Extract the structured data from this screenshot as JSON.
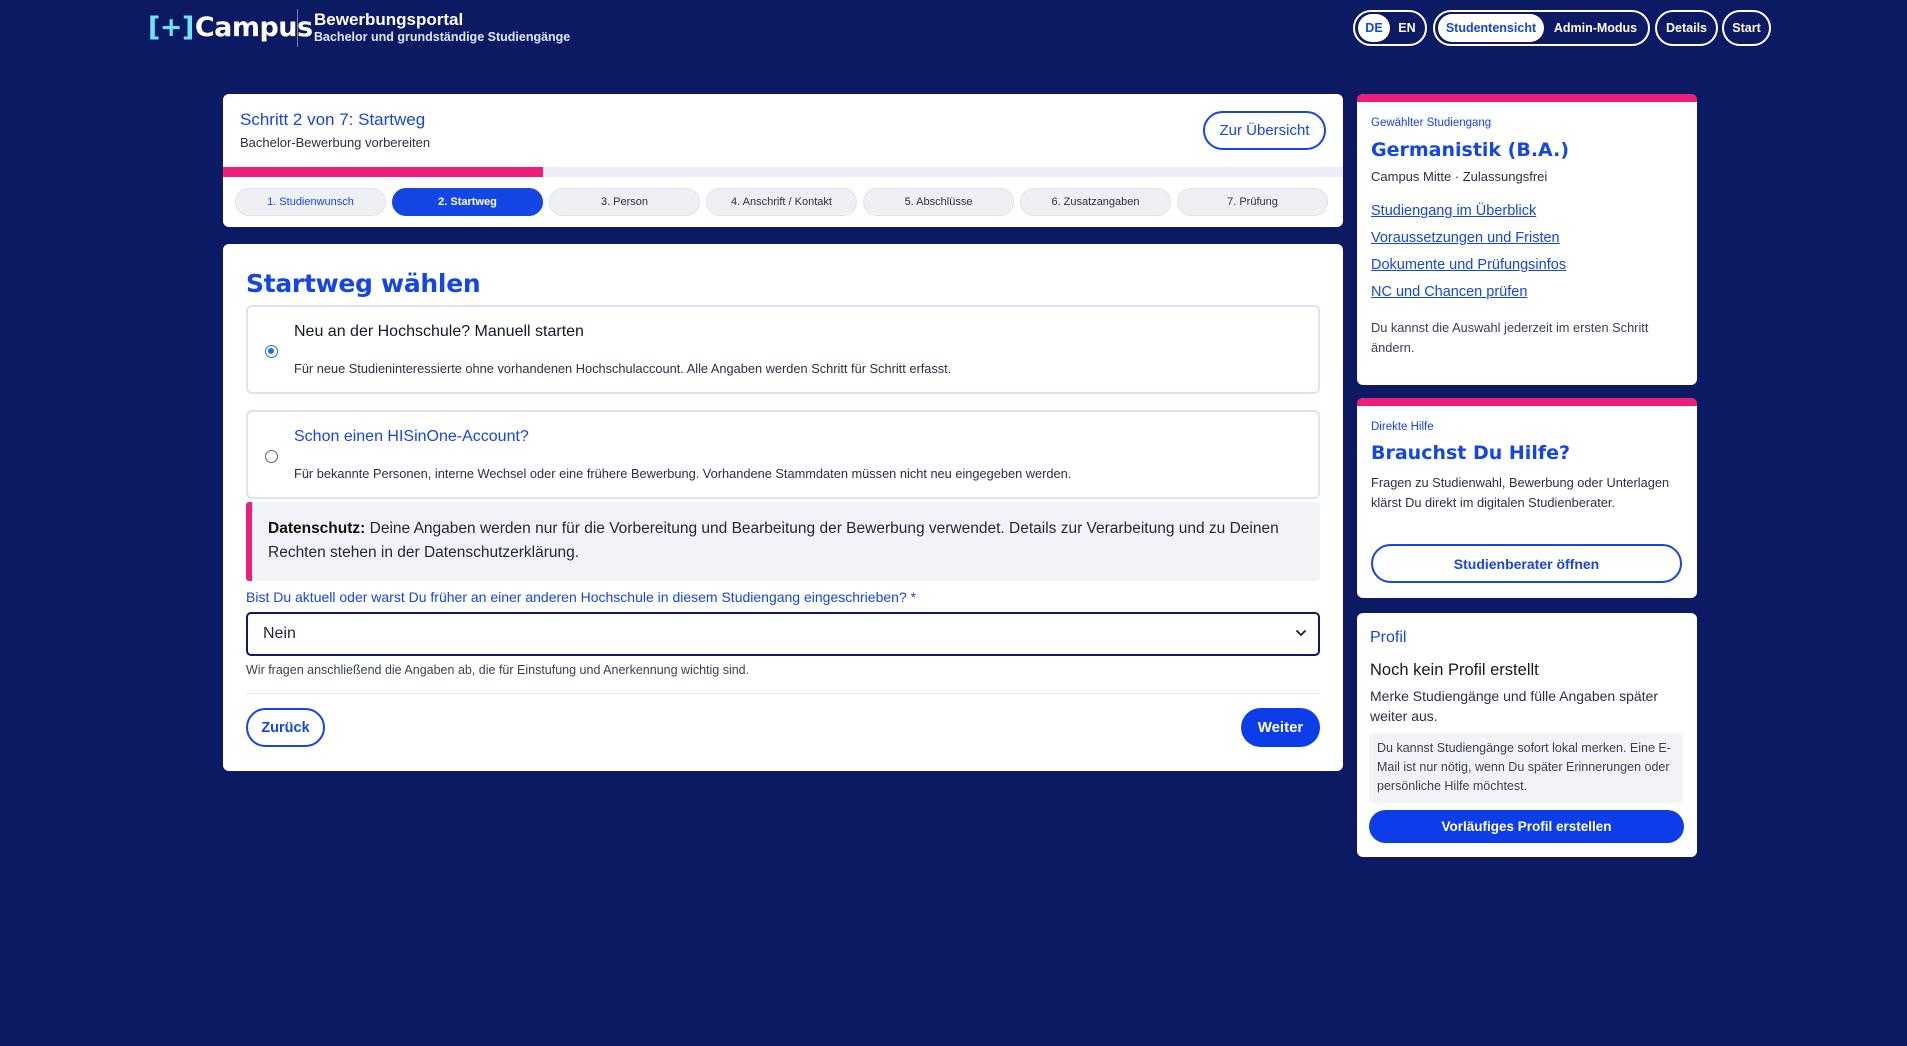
{
  "header": {
    "logo_text": "[+]Campus",
    "logo_mark": "[+]",
    "logo_word": "Campus",
    "portal_title": "Bewerbungsportal",
    "portal_subtitle": "Bachelor und grundständige Studiengänge",
    "languages": [
      "DE",
      "EN"
    ],
    "active_language": "DE",
    "views": [
      "Studentensicht",
      "Admin-Modus"
    ],
    "active_view": "Studentensicht",
    "details_label": "Details",
    "start_label": "Start"
  },
  "step_card": {
    "title": "Schritt 2 von 7: Startweg",
    "subtitle": "Bachelor-Bewerbung vorbereiten",
    "overview_button": "Zur Übersicht",
    "progress": 0.2857,
    "steps": [
      "1. Studienwunsch",
      "2. Startweg",
      "3. Person",
      "4. Anschrift / Kontakt",
      "5. Abschlüsse",
      "6. Zusatzangaben",
      "7. Prüfung"
    ],
    "active_step": 2
  },
  "main": {
    "heading": "Startweg wählen",
    "options": [
      {
        "title": "Neu an der Hochschule? Manuell starten",
        "description": "Für neue Studieninteressierte ohne vorhandenen Hochschulaccount. Alle Angaben werden Schritt für Schritt erfasst.",
        "selected": true
      },
      {
        "title": "Schon einen HISinOne-Account?",
        "description": "Für bekannte Personen, interne Wechsel oder eine frühere Bewerbung. Vorhandene Stammdaten müssen nicht neu eingegeben werden.",
        "selected": false
      }
    ],
    "privacy_label": "Datenschutz:",
    "privacy_text": "Deine Angaben werden nur für die Vorbereitung und Bearbeitung der Bewerbung verwendet. Details zur Verarbeitung und zu Deinen Rechten stehen in der Datenschutzerklärung.",
    "question_label": "Bist Du aktuell oder warst Du früher an einer anderen Hochschule in diesem Studiengang eingeschrieben? *",
    "select_value": "Nein",
    "hint": "Wir fragen anschließend die Angaben ab, die für Einstufung und Anerkennung wichtig sind.",
    "back_button": "Zurück",
    "next_button": "Weiter"
  },
  "program_card": {
    "kicker": "Gewählter Studiengang",
    "title": "Germanistik (B.A.)",
    "meta": "Campus Mitte · Zulassungsfrei",
    "links": [
      "Studiengang im Überblick",
      "Voraussetzungen und Fristen",
      "Dokumente und Prüfungsinfos",
      "NC und Chancen prüfen"
    ],
    "note": "Du kannst die Auswahl jederzeit im ersten Schritt ändern."
  },
  "help_card": {
    "kicker": "Direkte Hilfe",
    "title": "Brauchst Du Hilfe?",
    "text": "Fragen zu Studienwahl, Bewerbung oder Unterlagen klärst Du direkt im digitalen Studienberater.",
    "button": "Studienberater öffnen"
  },
  "profile_card": {
    "kicker": "Profil",
    "title": "Noch kein Profil erstellt",
    "text": "Merke Studiengänge und fülle Angaben später weiter aus.",
    "info": "Du kannst Studiengänge sofort lokal merken. Eine E-Mail ist nur nötig, wenn Du später Erinnerungen oder persönliche Hilfe möchtest.",
    "button": "Vorläufiges Profil erstellen"
  },
  "colors": {
    "page_bg": "#0b1a63",
    "accent": "#1446e6",
    "pink": "#ec1e79",
    "button_blue": "#0c3de8"
  },
  "icons": {
    "select_chevron": "chevron-down-icon"
  }
}
